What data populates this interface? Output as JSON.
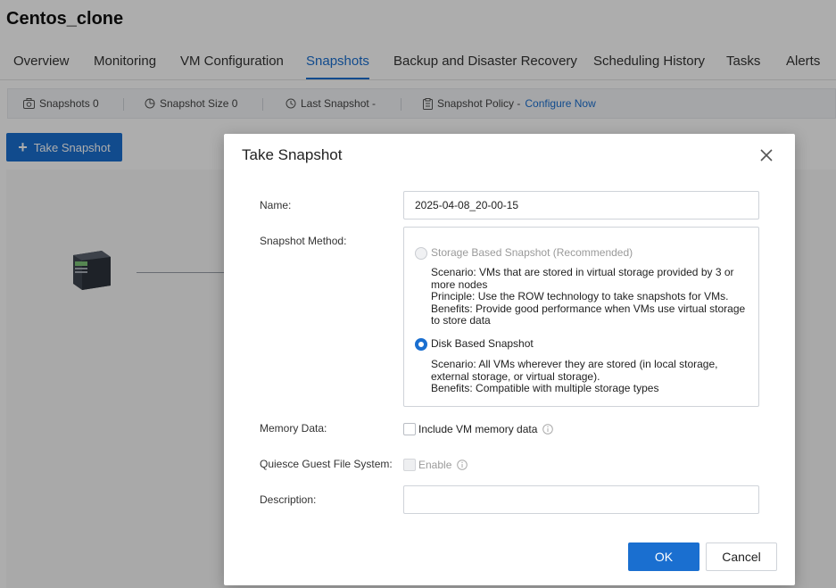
{
  "vm": {
    "title": "Centos_clone"
  },
  "tabs": [
    {
      "label": "Overview"
    },
    {
      "label": "Monitoring"
    },
    {
      "label": "VM Configuration"
    },
    {
      "label": "Snapshots"
    },
    {
      "label": "Backup and Disaster Recovery"
    },
    {
      "label": "Scheduling History"
    },
    {
      "label": "Tasks"
    },
    {
      "label": "Alerts"
    }
  ],
  "active_tab": "Snapshots",
  "stats": {
    "snapshots": "Snapshots 0",
    "snapshot_size": "Snapshot Size 0",
    "last_snapshot": "Last Snapshot -",
    "policy_prefix": "Snapshot Policy -",
    "policy_link": "Configure Now"
  },
  "toolbar": {
    "take_snapshot": "Take Snapshot"
  },
  "dialog": {
    "title": "Take Snapshot",
    "name_label": "Name:",
    "name_value": "2025-04-08_20-00-15",
    "method_label": "Snapshot Method:",
    "methods": [
      {
        "label": "Storage Based Snapshot (Recommended)",
        "disabled": true,
        "selected": false,
        "desc": [
          "Scenario: VMs that are stored in virtual storage provided by 3 or",
          "more nodes",
          "Principle: Use the ROW technology to take snapshots for VMs.",
          "Benefits: Provide good performance when VMs use virtual storage",
          "to store data"
        ]
      },
      {
        "label": "Disk Based Snapshot",
        "disabled": false,
        "selected": true,
        "desc": [
          "Scenario: All VMs wherever they are stored (in local storage,",
          "external storage, or virtual storage).",
          "Benefits: Compatible with multiple storage types"
        ]
      }
    ],
    "memory_label": "Memory Data:",
    "memory_option": "Include VM memory data",
    "quiesce_label": "Quiesce Guest File System:",
    "quiesce_option": "Enable",
    "description_label": "Description:",
    "description_value": "",
    "ok": "OK",
    "cancel": "Cancel"
  },
  "colors": {
    "accent": "#1a6fd0",
    "overlay": "rgba(0,0,0,0.32)"
  }
}
